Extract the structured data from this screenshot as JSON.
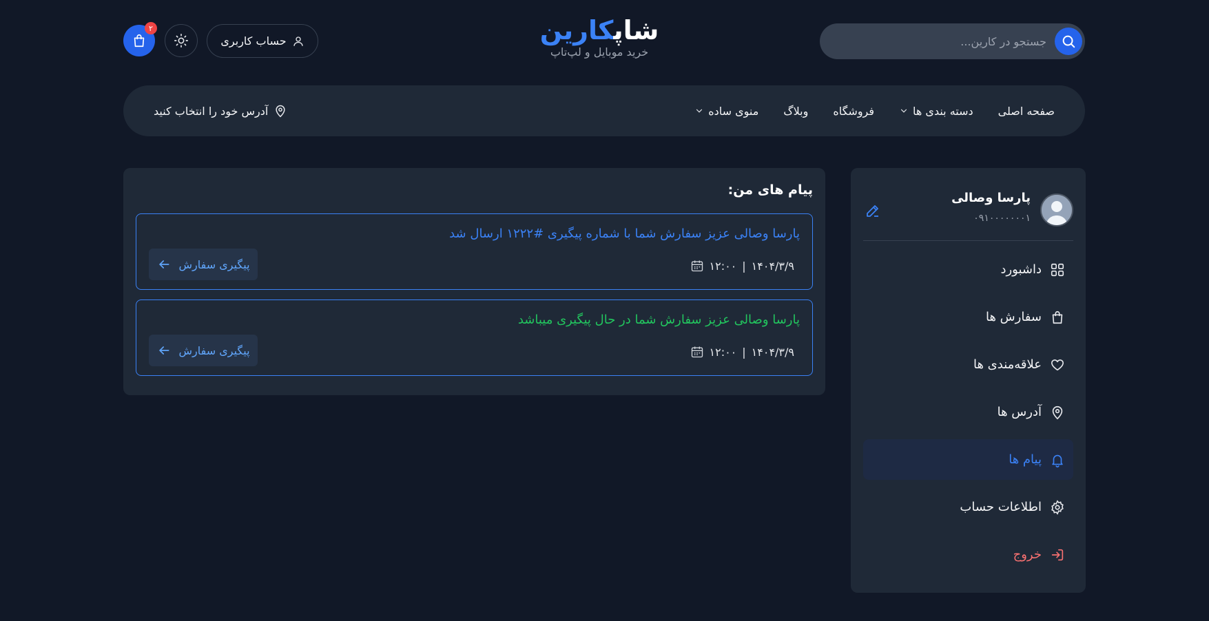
{
  "header": {
    "search": {
      "placeholder": "جستجو در کارین..."
    },
    "logo": {
      "title_part1": "کارین",
      "title_part2": "شاپ",
      "subtitle": "خرید موبایل و لپ‌تاپ"
    },
    "account_label": "حساب کاربری",
    "cart_count": "۲"
  },
  "nav": {
    "items": [
      {
        "label": "صفحه اصلی"
      },
      {
        "label": "دسته بندی ها"
      },
      {
        "label": "فروشگاه"
      },
      {
        "label": "وبلاگ"
      },
      {
        "label": "منوی ساده"
      }
    ],
    "location_label": "آدرس خود را انتخاب کنید"
  },
  "profile": {
    "name": "پارسا وصالی",
    "phone": "۰۹۱۰۰۰۰۰۰۰۱"
  },
  "menu": {
    "items": [
      {
        "label": "داشبورد",
        "icon": "dashboard-icon"
      },
      {
        "label": "سفارش ها",
        "icon": "bag-icon"
      },
      {
        "label": "علاقه‌مندی ها",
        "icon": "heart-icon"
      },
      {
        "label": "آدرس ها",
        "icon": "location-pin-icon"
      },
      {
        "label": "پیام ها",
        "icon": "bell-icon"
      },
      {
        "label": "اطلاعات حساب",
        "icon": "gear-icon"
      },
      {
        "label": "خروج",
        "icon": "logout-icon"
      }
    ]
  },
  "main": {
    "title": "پیام های من:",
    "messages": [
      {
        "text": "پارسا وصالی عزیز سفارش شما با شماره پیگیری #۱۲۲۲ ارسال شد",
        "date": "۱۴۰۴/۳/۹",
        "time": "۱۲:۰۰",
        "button": "پیگیری سفارش",
        "color": "#3b82f6"
      },
      {
        "text": "پارسا وصالی عزیز سفارش شما در حال پیگیری میباشد",
        "date": "۱۴۰۴/۳/۹",
        "time": "۱۲:۰۰",
        "button": "پیگیری سفارش",
        "color": "#22c55e"
      }
    ]
  },
  "colors": {
    "accent": "#2563eb",
    "background": "#111827",
    "panel": "#1f2937",
    "danger": "#f87171"
  }
}
